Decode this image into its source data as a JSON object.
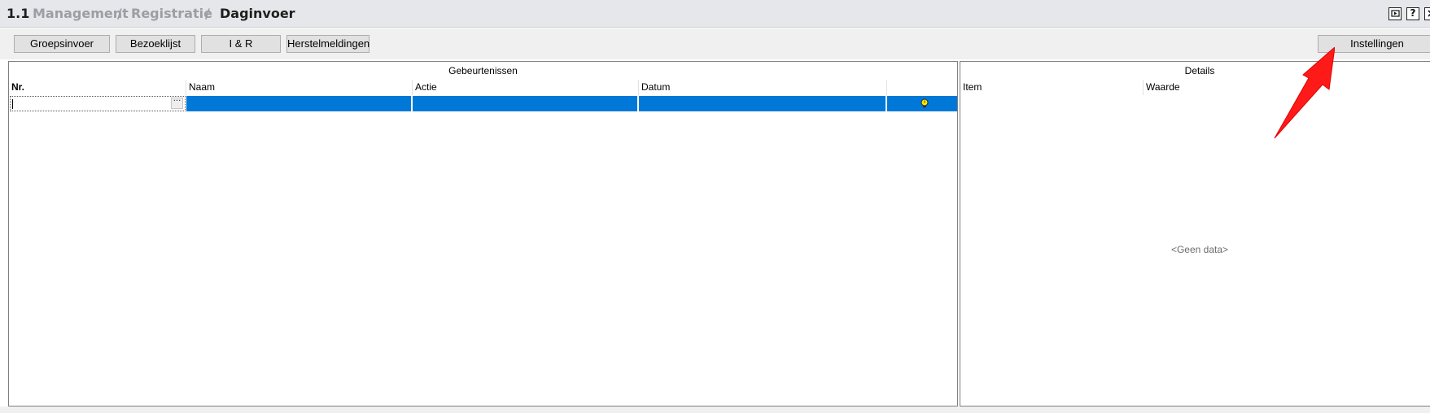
{
  "breadcrumb": {
    "number": "1.1",
    "items": [
      "Management",
      "Registratie"
    ],
    "separator": "/",
    "current": "Daginvoer"
  },
  "window_icons": {
    "help": "?"
  },
  "toolbar": {
    "buttons": [
      "Groepsinvoer",
      "Bezoeklijst",
      "I & R",
      "Herstelmeldingen"
    ],
    "settings_label": "Instellingen"
  },
  "events_panel": {
    "title": "Gebeurtenissen",
    "columns": [
      "Nr.",
      "Naam",
      "Actie",
      "Datum"
    ],
    "row": {
      "ellipsis": "···",
      "selected_color": "#0078d7"
    }
  },
  "details_panel": {
    "title": "Details",
    "columns": [
      "Item",
      "Waarde"
    ],
    "empty_text": "<Geen data>"
  },
  "annotation": {
    "arrow_color": "#ff1a1a"
  }
}
